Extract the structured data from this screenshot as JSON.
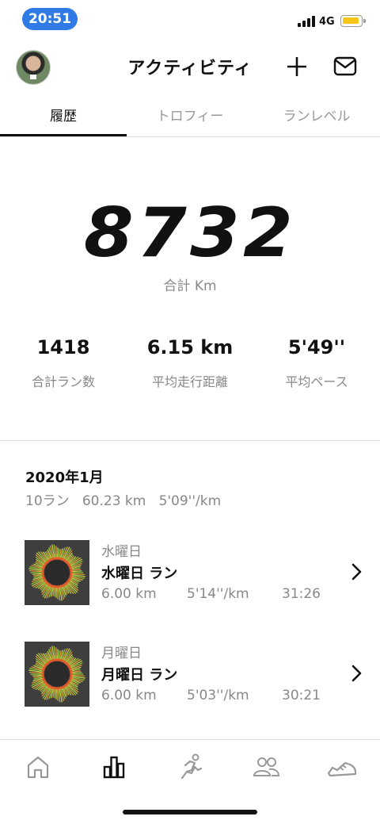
{
  "status": {
    "time": "20:51",
    "network": "4G",
    "battery_color": "#f5c518"
  },
  "header": {
    "title": "アクティビティ",
    "add_icon": "plus-icon",
    "inbox_icon": "mail-icon"
  },
  "tabs": [
    {
      "label": "履歴",
      "active": true
    },
    {
      "label": "トロフィー",
      "active": false
    },
    {
      "label": "ランレベル",
      "active": false
    }
  ],
  "summary": {
    "total_value": "8732",
    "total_label": "合計 Km",
    "stats": [
      {
        "value": "1418",
        "label": "合計ラン数"
      },
      {
        "value": "6.15 km",
        "label": "平均走行距離"
      },
      {
        "value": "5'49''",
        "label": "平均ペース"
      }
    ]
  },
  "month": {
    "title": "2020年1月",
    "runs": "10ラン",
    "distance": "60.23 km",
    "pace": "5'09''/km"
  },
  "runs": [
    {
      "day": "水曜日",
      "name": "水曜日 ラン",
      "distance": "6.00 km",
      "pace": "5'14''/km",
      "duration": "31:26"
    },
    {
      "day": "月曜日",
      "name": "月曜日 ラン",
      "distance": "6.00 km",
      "pace": "5'03''/km",
      "duration": "30:21"
    }
  ],
  "bottom_nav": [
    {
      "icon": "home-icon",
      "active": false
    },
    {
      "icon": "activity-chart-icon",
      "active": true
    },
    {
      "icon": "run-icon",
      "active": false
    },
    {
      "icon": "community-icon",
      "active": false
    },
    {
      "icon": "shoe-icon",
      "active": false
    }
  ],
  "accent_color": "#2f7ae5"
}
